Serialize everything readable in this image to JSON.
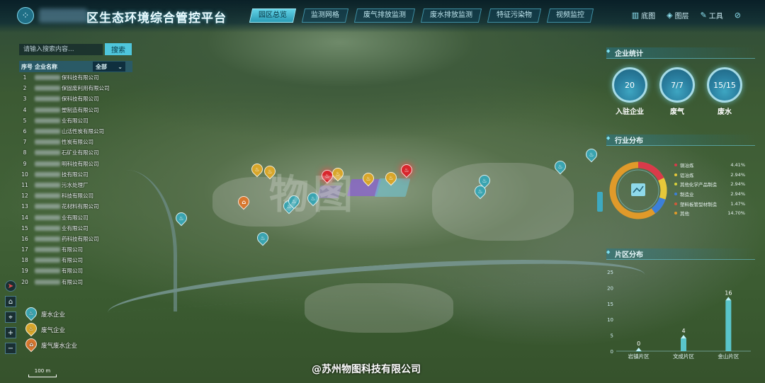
{
  "header": {
    "logo_glyph": "⁘",
    "title": "区生态环境综合管控平台",
    "tabs": [
      {
        "label": "园区总览",
        "active": true
      },
      {
        "label": "监测网格",
        "active": false
      },
      {
        "label": "废气排放监测",
        "active": false
      },
      {
        "label": "废水排放监测",
        "active": false
      },
      {
        "label": "特征污染物",
        "active": false
      },
      {
        "label": "视频监控",
        "active": false
      }
    ],
    "tools": [
      {
        "icon": "map-icon",
        "glyph": "▥",
        "label": "底图"
      },
      {
        "icon": "layers-icon",
        "glyph": "◈",
        "label": "图层"
      },
      {
        "icon": "wrench-icon",
        "glyph": "✎",
        "label": "工具"
      },
      {
        "icon": "hide-icon",
        "glyph": "⊘",
        "label": ""
      }
    ],
    "accent": "#4fc6dc"
  },
  "search": {
    "placeholder": "请输入搜索内容...",
    "button_label": "搜索"
  },
  "company_list": {
    "header": {
      "index": "序号",
      "name": "企业名称",
      "filter": "全部"
    },
    "rows": [
      {
        "num": "1",
        "name": "保科技有限公司"
      },
      {
        "num": "2",
        "name": "保固废利用有限公司"
      },
      {
        "num": "3",
        "name": "保科技有限公司"
      },
      {
        "num": "4",
        "name": "塑制造有限公司"
      },
      {
        "num": "5",
        "name": "业有限公司"
      },
      {
        "num": "6",
        "name": "山活性炭有限公司"
      },
      {
        "num": "7",
        "name": "性炭有限公司"
      },
      {
        "num": "8",
        "name": "石矿业有限公司"
      },
      {
        "num": "9",
        "name": "明科技有限公司"
      },
      {
        "num": "10",
        "name": "技有限公司"
      },
      {
        "num": "11",
        "name": "污水处理厂"
      },
      {
        "num": "12",
        "name": "科技有限公司"
      },
      {
        "num": "13",
        "name": "花材料有限公司"
      },
      {
        "num": "14",
        "name": "业有限公司"
      },
      {
        "num": "15",
        "name": "业有限公司"
      },
      {
        "num": "16",
        "name": "药科技有限公司"
      },
      {
        "num": "17",
        "name": "有限公司"
      },
      {
        "num": "18",
        "name": "有限公司"
      },
      {
        "num": "19",
        "name": "有限公司"
      },
      {
        "num": "20",
        "name": "有限公司"
      }
    ]
  },
  "legend": [
    {
      "type": "water",
      "label": "废水企业",
      "color": "#3aa4b0"
    },
    {
      "type": "gas",
      "label": "废气企业",
      "color": "#d8a62a"
    },
    {
      "type": "both",
      "label": "废气废水企业",
      "color": "#d7772f"
    }
  ],
  "map": {
    "scale_label": "100 m",
    "controls": [
      "compass-icon",
      "home-icon",
      "locate-icon",
      "zoom-in-icon",
      "zoom-out-icon"
    ],
    "watermark": "物图",
    "credit": "@苏州物图科技有限公司"
  },
  "enterprise_stats": {
    "title": "企业统计",
    "items": [
      {
        "value": "20",
        "label": "入驻企业"
      },
      {
        "value": "7/7",
        "label": "废气"
      },
      {
        "value": "15/15",
        "label": "废水"
      }
    ]
  },
  "industry": {
    "title": "行业分布",
    "items": [
      {
        "name": "铜冶炼",
        "value": "4.41%",
        "color": "#d93a4a"
      },
      {
        "name": "铝冶炼",
        "value": "2.94%",
        "color": "#e6c83a"
      },
      {
        "name": "其他化学产品制造",
        "value": "2.94%",
        "color": "#d8d23a"
      },
      {
        "name": "制造业",
        "value": "2.94%",
        "color": "#3b7fd9"
      },
      {
        "name": "塑料板管型材制造",
        "value": "1.47%",
        "color": "#d05a3a"
      },
      {
        "name": "其他",
        "value": "14.70%",
        "color": "#e09a2a"
      }
    ]
  },
  "chart_data": {
    "type": "bar",
    "title": "片区分布",
    "categories": [
      "岩镇片区",
      "文成片区",
      "金山片区"
    ],
    "values": [
      0,
      4,
      16
    ],
    "ylim": [
      0,
      25
    ],
    "yticks": [
      0,
      5,
      10,
      15,
      20,
      25
    ],
    "color": "#5fd8e6"
  }
}
